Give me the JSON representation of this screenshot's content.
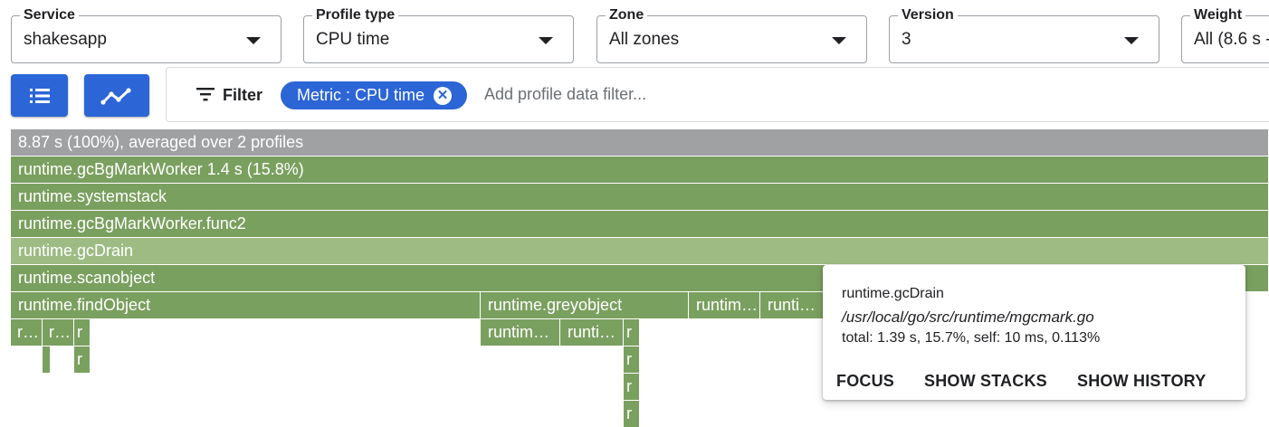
{
  "toolbar": {
    "service": {
      "label": "Service",
      "value": "shakesapp"
    },
    "profile_type": {
      "label": "Profile type",
      "value": "CPU time"
    },
    "zone": {
      "label": "Zone",
      "value": "All zones"
    },
    "version": {
      "label": "Version",
      "value": "3"
    },
    "weight": {
      "label": "Weight",
      "value": "All (8.6 s -"
    }
  },
  "view_buttons": [
    {
      "icon": "list-icon"
    },
    {
      "icon": "trend-line-icon"
    }
  ],
  "filter": {
    "label": "Filter",
    "chip_text": "Metric : CPU time",
    "placeholder": "Add profile data filter..."
  },
  "flame": {
    "root": "8.87 s (100%), averaged over 2 profiles",
    "rows": [
      "runtime.gcBgMarkWorker 1.4 s (15.8%)",
      "runtime.systemstack",
      "runtime.gcBgMarkWorker.func2",
      "runtime.gcDrain",
      "runtime.scanobject"
    ],
    "level7": {
      "find_object": "runtime.findObject",
      "grey_object": "runtime.greyobject",
      "runtim_a": "runtim…",
      "runti_b": "runti…"
    },
    "level8": {
      "r1": "r…",
      "r2": "r…",
      "r3": "r",
      "runtim": "runtim…",
      "runti": "runti…",
      "r4": "r"
    },
    "level9": {
      "r1": "r",
      "r2": "r"
    },
    "level10": {
      "r": "r"
    },
    "level11": {
      "r": "r"
    }
  },
  "tooltip": {
    "function": "runtime.gcDrain",
    "path": "/usr/local/go/src/runtime/mgcmark.go",
    "stats": "total: 1.39 s, 15.7%, self: 10 ms, 0.113%",
    "actions": [
      "FOCUS",
      "SHOW STACKS",
      "SHOW HISTORY"
    ]
  },
  "colors": {
    "accent_blue": "#2c65d6",
    "frame_green": "#7aa05f",
    "frame_highlight": "#9dbb83",
    "root_grey": "#a0a1a3"
  }
}
